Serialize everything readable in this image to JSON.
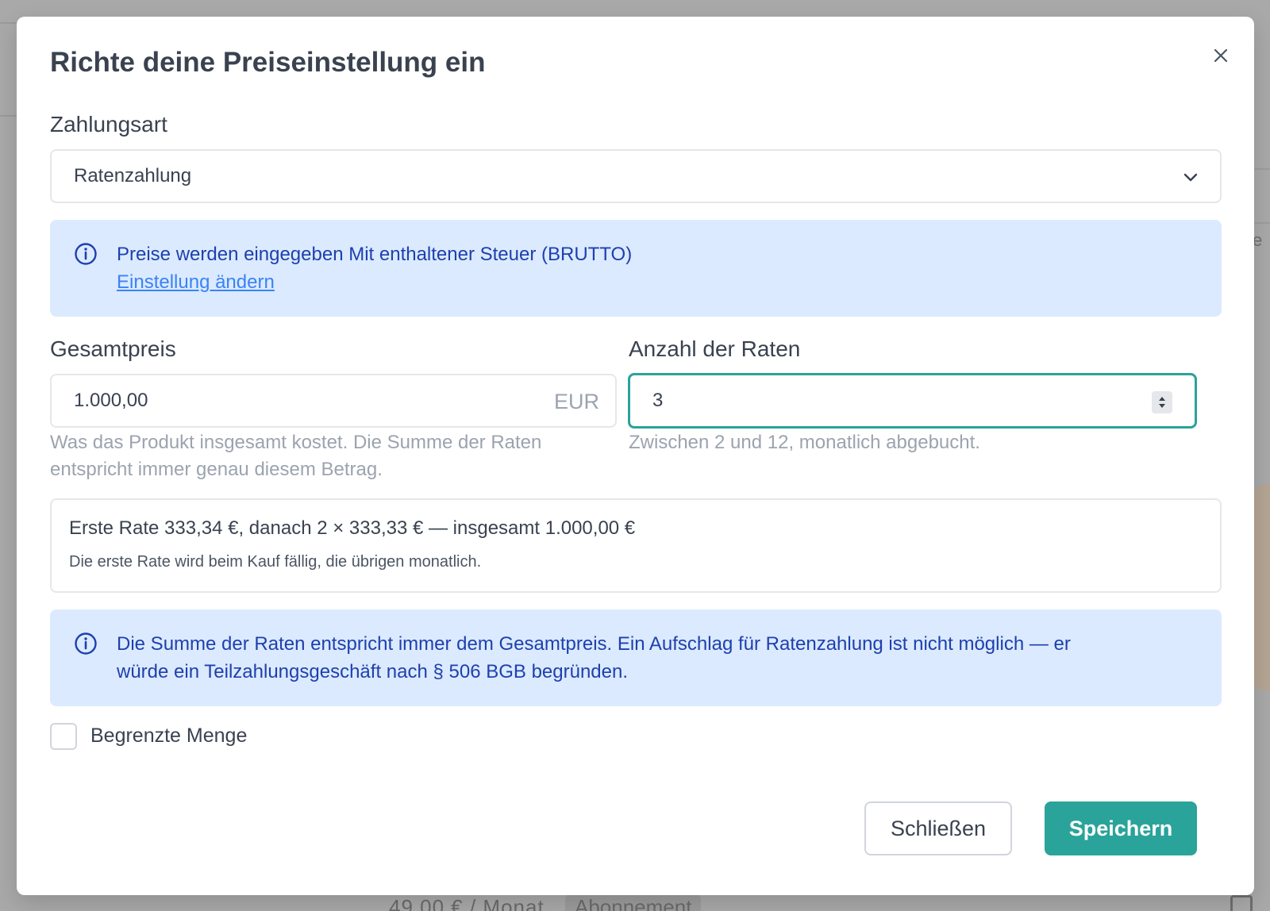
{
  "dialog": {
    "title": "Richte deine Preiseinstellung ein",
    "close_icon": "close-icon"
  },
  "payment_type": {
    "label": "Zahlungsart",
    "selected": "Ratenzahlung"
  },
  "tax_notice": {
    "text": "Preise werden eingegeben Mit enthaltener Steuer (BRUTTO)",
    "link": "Einstellung ändern"
  },
  "total_price": {
    "label": "Gesamtpreis",
    "value": "1.000,00",
    "suffix": "EUR",
    "help_line1": "Was das Produkt insgesamt kostet. Die Summe der Raten",
    "help_line2": "entspricht immer genau diesem Betrag."
  },
  "installments": {
    "label": "Anzahl der Raten",
    "value": "3",
    "help": "Zwischen 2 und 12, monatlich abgebucht."
  },
  "summary": {
    "main": "Erste Rate 333,34 €, danach 2 × 333,33 € — insgesamt 1.000,00 €",
    "sub": "Die erste Rate wird beim Kauf fällig, die übrigen monatlich."
  },
  "legal_notice": {
    "line1": "Die Summe der Raten entspricht immer dem Gesamtpreis. Ein Aufschlag für Ratenzahlung ist nicht möglich — er",
    "line2": "würde ein Teilzahlungsgeschäft nach § 506 BGB begründen."
  },
  "limited_quantity": {
    "label": "Begrenzte Menge",
    "checked": false
  },
  "buttons": {
    "close": "Schließen",
    "save": "Speichern"
  },
  "background": {
    "letter": "e",
    "price_text": "49,00 € / Monat",
    "badge": "Abonnement"
  },
  "colors": {
    "accent": "#2aa39a",
    "info_bg": "#dbeafe",
    "info_text": "#1e40af",
    "link": "#3b82f6"
  }
}
